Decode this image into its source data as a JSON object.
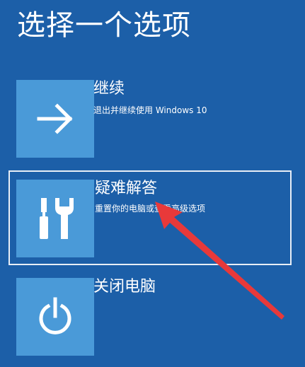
{
  "page": {
    "title": "选择一个选项"
  },
  "options": [
    {
      "title": "继续",
      "description": "退出并继续使用 Windows 10",
      "icon": "arrow-right-icon"
    },
    {
      "title": "疑难解答",
      "description": "重置你的电脑或查看高级选项",
      "icon": "wrench-screwdriver-icon",
      "selected": true
    },
    {
      "title": "关闭电脑",
      "description": "",
      "icon": "power-icon"
    }
  ],
  "colors": {
    "background": "#1c5fa8",
    "tile": "#4a9ad8",
    "text": "#ffffff",
    "annotation_arrow": "#e8393a"
  }
}
